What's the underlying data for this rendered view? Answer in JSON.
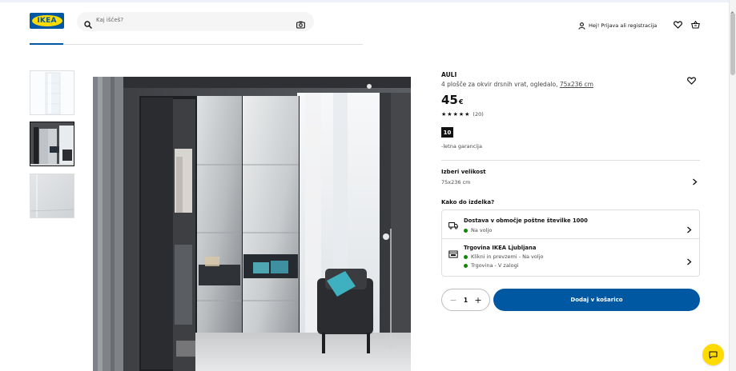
{
  "header": {
    "logo_text": "IKEA",
    "search_placeholder": "Kaj iščeš?",
    "account_label": "Hej! Prijava ali registracija"
  },
  "product": {
    "name": "AULI",
    "description": "4 plošče za okvir drsnih vrat, ogledalo,",
    "measurement": "75x236 cm",
    "price_value": "45",
    "price_currency": "€",
    "rating_stars": 5,
    "rating_count": "(20)",
    "guarantee_years": "10",
    "guarantee_text": "-letna garancija"
  },
  "size": {
    "title": "Izberi velikost",
    "value": "75x236 cm"
  },
  "availability": {
    "title": "Kako do izdelka?",
    "delivery_title": "Dostava v območje poštne številke 1000",
    "delivery_status": "Na voljo",
    "store_title": "Trgovina IKEA Ljubljana",
    "store_status_1": "Klikni in prevzemi - Na voljo",
    "store_status_2": "Trgovina - V zalogi"
  },
  "cart": {
    "quantity": "1",
    "minus": "−",
    "plus": "+",
    "add_label": "Dodaj v košarico"
  },
  "colors": {
    "brand_blue": "#0058a3",
    "brand_yellow": "#ffdb00",
    "status_green": "#0a8a00"
  }
}
